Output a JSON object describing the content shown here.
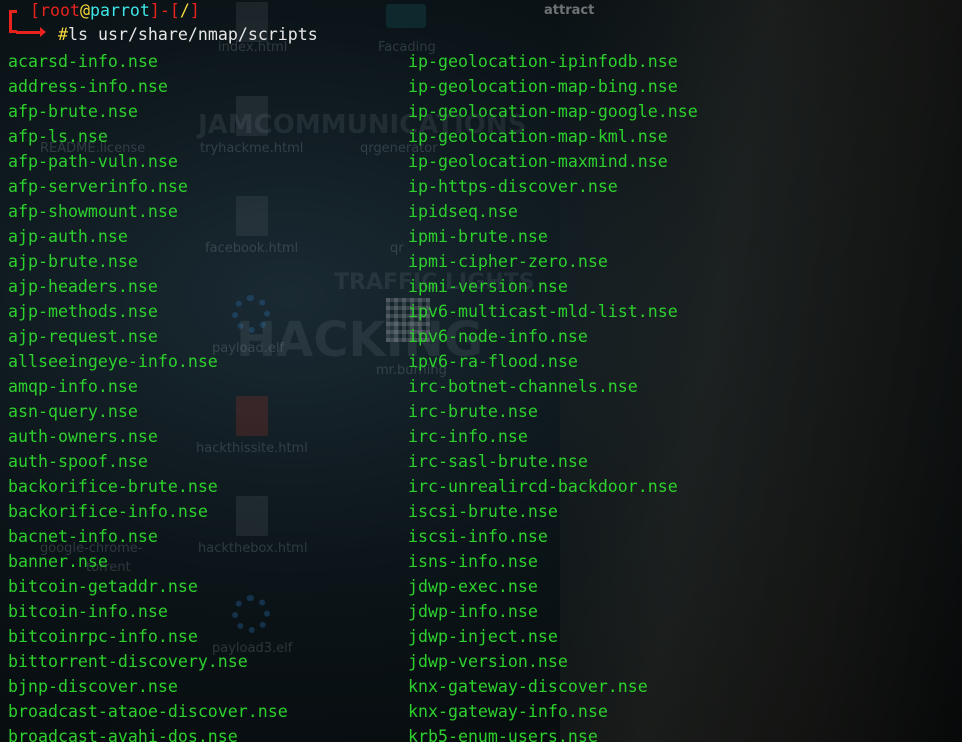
{
  "prompt": {
    "open_bracket": "[",
    "user": "root",
    "at": "@",
    "host": "parrot",
    "mid": "]-[",
    "cwd": "/",
    "close_bracket": "]",
    "symbol": "#",
    "command": "ls usr/share/nmap/scripts"
  },
  "listing": {
    "left": [
      "acarsd-info.nse",
      "address-info.nse",
      "afp-brute.nse",
      "afp-ls.nse",
      "afp-path-vuln.nse",
      "afp-serverinfo.nse",
      "afp-showmount.nse",
      "ajp-auth.nse",
      "ajp-brute.nse",
      "ajp-headers.nse",
      "ajp-methods.nse",
      "ajp-request.nse",
      "allseeingeye-info.nse",
      "amqp-info.nse",
      "asn-query.nse",
      "auth-owners.nse",
      "auth-spoof.nse",
      "backorifice-brute.nse",
      "backorifice-info.nse",
      "bacnet-info.nse",
      "banner.nse",
      "bitcoin-getaddr.nse",
      "bitcoin-info.nse",
      "bitcoinrpc-info.nse",
      "bittorrent-discovery.nse",
      "bjnp-discover.nse",
      "broadcast-ataoe-discover.nse",
      "broadcast-avahi-dos.nse"
    ],
    "right": [
      "ip-geolocation-ipinfodb.nse",
      "ip-geolocation-map-bing.nse",
      "ip-geolocation-map-google.nse",
      "ip-geolocation-map-kml.nse",
      "ip-geolocation-maxmind.nse",
      "ip-https-discover.nse",
      "ipidseq.nse",
      "ipmi-brute.nse",
      "ipmi-cipher-zero.nse",
      "ipmi-version.nse",
      "ipv6-multicast-mld-list.nse",
      "ipv6-node-info.nse",
      "ipv6-ra-flood.nse",
      "irc-botnet-channels.nse",
      "irc-brute.nse",
      "irc-info.nse",
      "irc-sasl-brute.nse",
      "irc-unrealircd-backdoor.nse",
      "iscsi-brute.nse",
      "iscsi-info.nse",
      "isns-info.nse",
      "jdwp-exec.nse",
      "jdwp-info.nse",
      "jdwp-inject.nse",
      "jdwp-version.nse",
      "knx-gateway-discover.nse",
      "knx-gateway-info.nse",
      "krb5-enum-users.nse"
    ]
  },
  "wallpaper": {
    "captions": [
      "attract",
      "Facading",
      "index.html",
      "tryhackme.html",
      "qrgenerator",
      "facebook.html",
      "qr",
      "payload.elf",
      "mr.burning",
      "hackthissite.html",
      "hackthebox.html",
      "payload3.elf",
      "README.license",
      "google-chrome-",
      "torrent"
    ],
    "headline_1": "JAMCOMMUNICATIONS",
    "headline_2": "TRAFFIC LIGHTS",
    "headline_3": "HACKING"
  },
  "colors": {
    "text_green": "#2dd12d",
    "prompt_red": "#e8231e",
    "host_cyan": "#3ee6e6",
    "symbol_yellow": "#f2d53c",
    "command_white": "#e6e6e6"
  }
}
